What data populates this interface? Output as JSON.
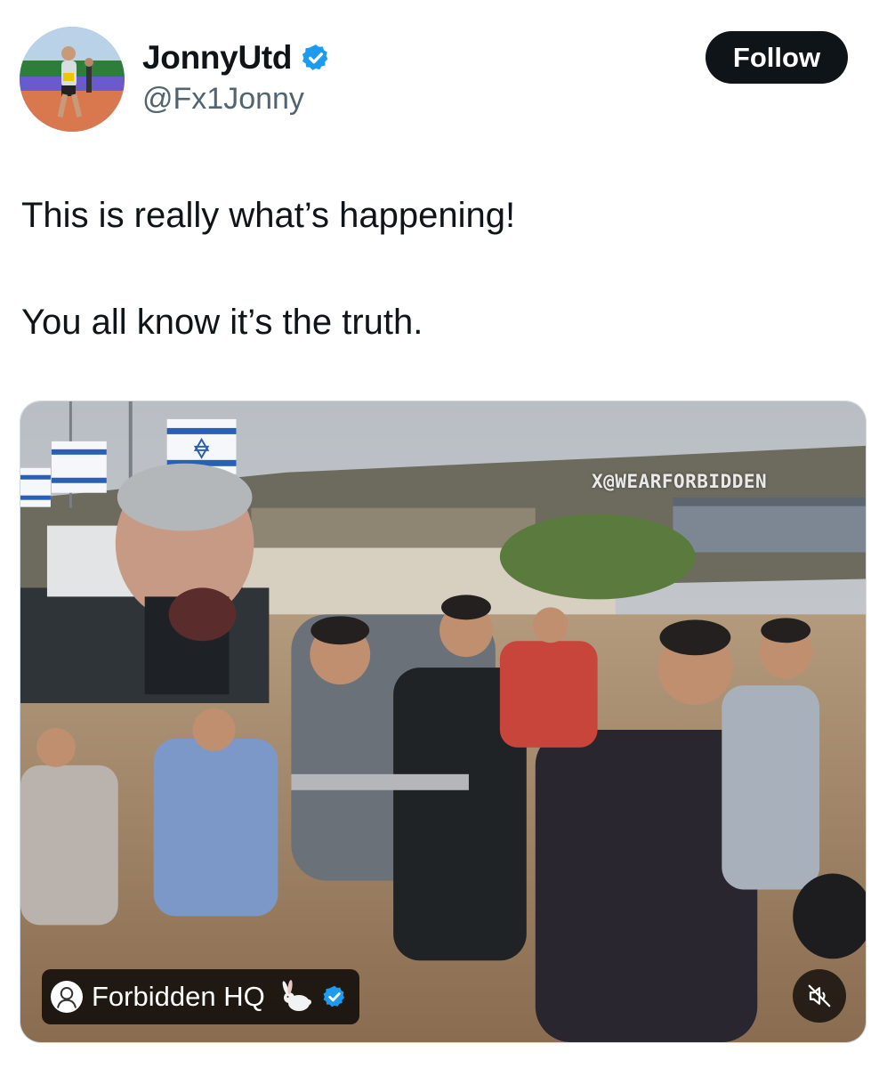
{
  "author": {
    "display_name": "JonnyUtd",
    "handle": "@Fx1Jonny",
    "verified": true,
    "avatar_icon": "runner-avatar"
  },
  "actions": {
    "follow_label": "Follow"
  },
  "tweet": {
    "lines": [
      "This is really what’s happening!",
      "You all know it’s the truth."
    ]
  },
  "media": {
    "watermark": "X@WEARFORBIDDEN",
    "source_name": "Forbidden HQ",
    "source_verified": true,
    "source_emoji_icon": "rabbit-icon",
    "mute_icon": "speaker-muted-icon"
  },
  "colors": {
    "verified_blue": "#1d9bf0",
    "follow_bg": "#0f1419",
    "handle_gray": "#536471"
  }
}
